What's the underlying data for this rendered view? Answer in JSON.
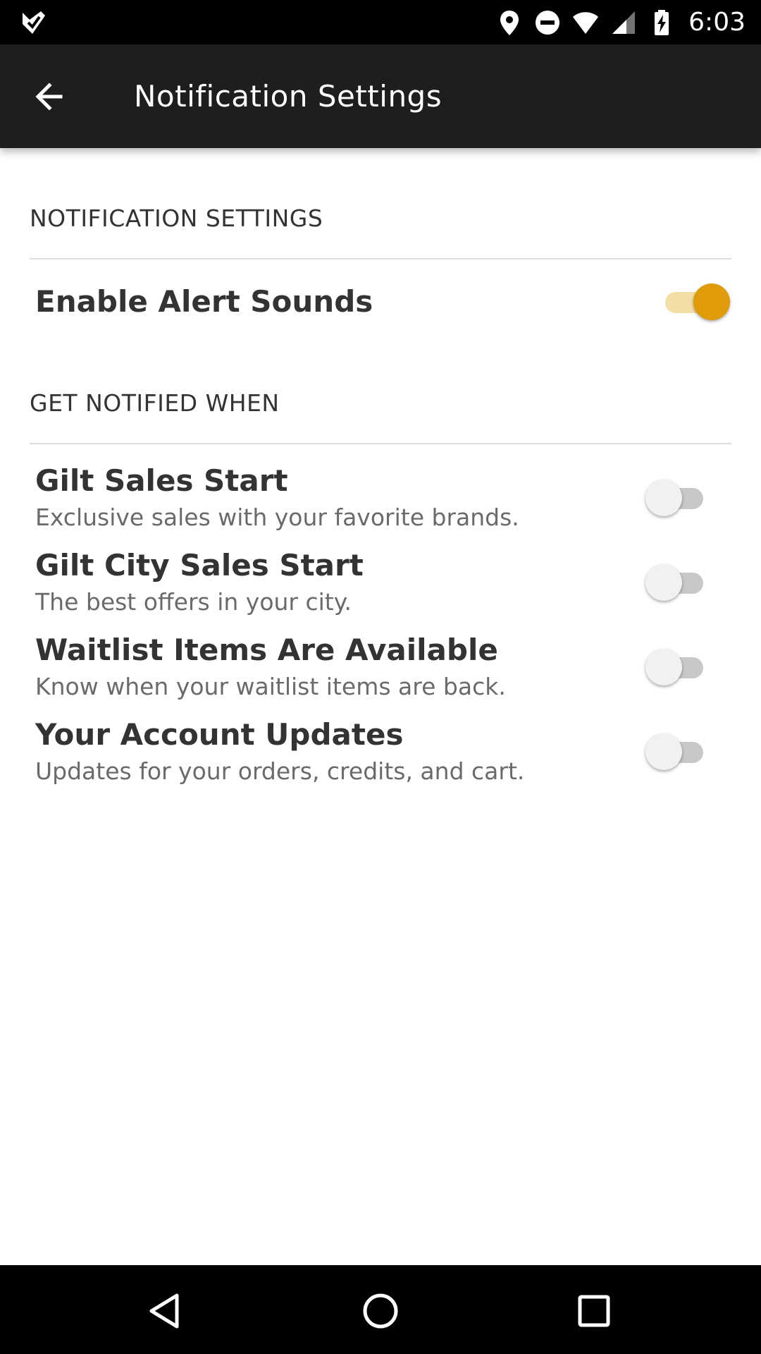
{
  "status_bar": {
    "time": "6:03",
    "icons": [
      "app-notification-icon",
      "location-icon",
      "do-not-disturb-icon",
      "wifi-icon",
      "signal-icon",
      "battery-charging-icon"
    ]
  },
  "app_bar": {
    "title": "Notification Settings",
    "back_icon": "arrow-back-icon"
  },
  "sections": {
    "notification_settings": {
      "header": "NOTIFICATION SETTINGS",
      "items": [
        {
          "title": "Enable Alert Sounds",
          "enabled": true
        }
      ]
    },
    "get_notified_when": {
      "header": "GET NOTIFIED WHEN",
      "items": [
        {
          "title": "Gilt Sales Start",
          "subtitle": "Exclusive sales with your favorite brands.",
          "enabled": false
        },
        {
          "title": "Gilt City Sales Start",
          "subtitle": "The best offers in your city.",
          "enabled": false
        },
        {
          "title": "Waitlist Items Are Available",
          "subtitle": "Know when your waitlist items are back.",
          "enabled": false
        },
        {
          "title": "Your Account Updates",
          "subtitle": "Updates for your orders, credits, and cart.",
          "enabled": false
        }
      ]
    }
  },
  "colors": {
    "accent": "#e09b0b",
    "accent_track": "#f2dfa6",
    "app_bar": "#1e1e1e"
  },
  "nav_bar": {
    "icons": [
      "nav-back-icon",
      "nav-home-icon",
      "nav-recents-icon"
    ]
  }
}
